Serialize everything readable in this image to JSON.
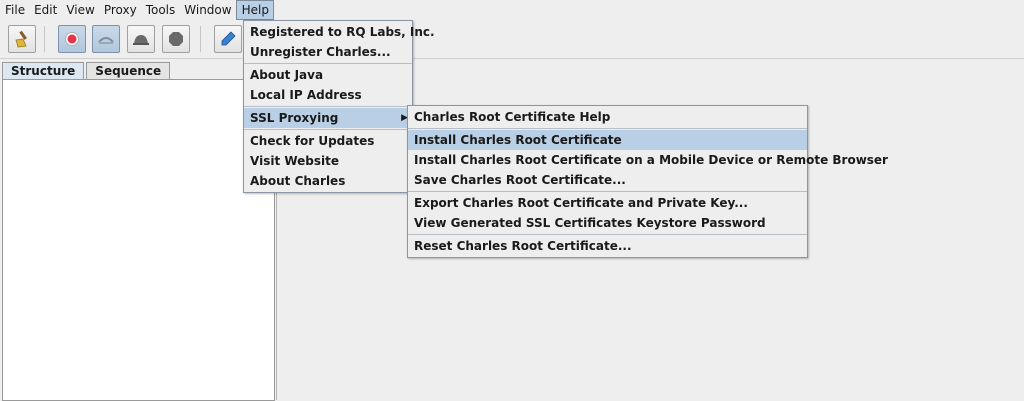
{
  "menubar": {
    "items": [
      {
        "label": "File"
      },
      {
        "label": "Edit"
      },
      {
        "label": "View"
      },
      {
        "label": "Proxy"
      },
      {
        "label": "Tools"
      },
      {
        "label": "Window"
      },
      {
        "label": "Help"
      }
    ]
  },
  "toolbar": {
    "buttons": [
      {
        "icon": "broom-icon"
      },
      {
        "icon": "record-icon",
        "color": "#e8344a"
      },
      {
        "icon": "throttle-icon"
      },
      {
        "icon": "breakpoint-icon"
      },
      {
        "icon": "stop-icon"
      },
      {
        "icon": "pen-icon",
        "color": "#3a7fd4"
      }
    ]
  },
  "tabs": [
    {
      "label": "Structure"
    },
    {
      "label": "Sequence"
    }
  ],
  "help_menu": {
    "groups": [
      [
        {
          "label": "Registered to RQ Labs, Inc."
        },
        {
          "label": "Unregister Charles..."
        }
      ],
      [
        {
          "label": "About Java"
        },
        {
          "label": "Local IP Address"
        }
      ],
      [
        {
          "label": "SSL Proxying"
        }
      ],
      [
        {
          "label": "Check for Updates"
        },
        {
          "label": "Visit Website"
        },
        {
          "label": "About Charles"
        }
      ]
    ]
  },
  "ssl_submenu": {
    "groups": [
      [
        {
          "label": "Charles Root Certificate Help"
        }
      ],
      [
        {
          "label": "Install Charles Root Certificate"
        },
        {
          "label": "Install Charles Root Certificate on a Mobile Device or Remote Browser"
        },
        {
          "label": "Save Charles Root Certificate..."
        }
      ],
      [
        {
          "label": "Export Charles Root Certificate and Private Key..."
        },
        {
          "label": "View Generated SSL Certificates Keystore Password"
        }
      ],
      [
        {
          "label": "Reset Charles Root Certificate..."
        }
      ]
    ]
  },
  "colors": {
    "highlight": "#b8cfe5",
    "background": "#eeeeee"
  }
}
